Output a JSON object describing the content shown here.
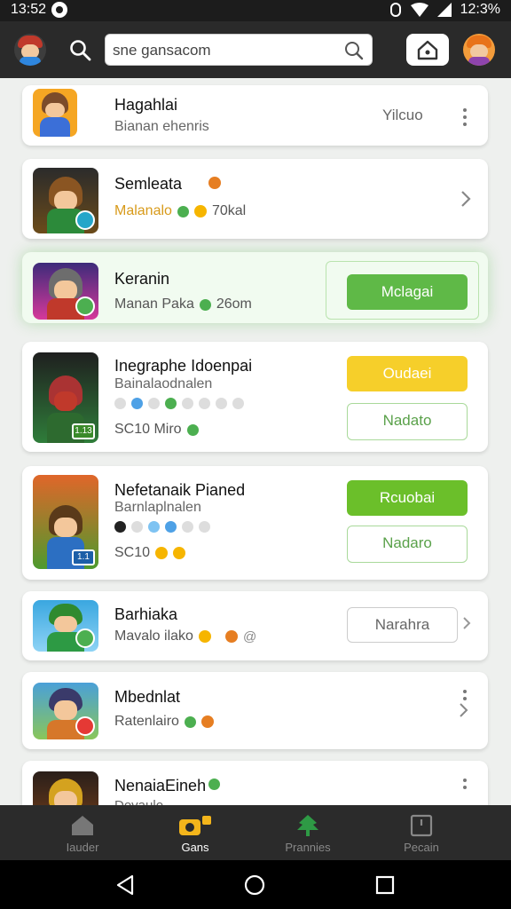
{
  "status": {
    "time": "13:52",
    "battery": "12:3%"
  },
  "header": {
    "search_value": "sne gansacom"
  },
  "items": [
    {
      "title": "Hagahlai",
      "subtitle": "Bianan ehenris",
      "action": "Yilcuo"
    },
    {
      "title": "Semleata",
      "meta": "Malanalo",
      "meta2": "70kal"
    },
    {
      "title": "Keranin",
      "meta": "Manan Paka",
      "meta2": "26om",
      "button": "Mclagai"
    },
    {
      "title": "Inegraphe Idoenpai",
      "subtitle": "Bainalaodnalen",
      "meta": "SC10 Miro",
      "button1": "Oudaei",
      "button2": "Nadato",
      "badge": "1.13"
    },
    {
      "title": "Nefetanaik Pianed",
      "subtitle": "Barnlaplnalen",
      "meta": "SC10",
      "button1": "Rcuobai",
      "button2": "Nadaro",
      "badge": "1.1"
    },
    {
      "title": "Barhiaka",
      "meta": "Mavalo ilako",
      "button": "Narahra"
    },
    {
      "title": "Mbednlat",
      "meta": "Ratenlairo"
    },
    {
      "title": "NenaiaEineh",
      "meta": "Dovaulo"
    }
  ],
  "tabs": [
    {
      "label": "Iauder"
    },
    {
      "label": "Gans"
    },
    {
      "label": "Prannies"
    },
    {
      "label": "Pecain"
    }
  ],
  "colors": {
    "accent": "#6bbf2a",
    "yellow": "#f6cf2a",
    "appbar": "#2a2a2a"
  }
}
